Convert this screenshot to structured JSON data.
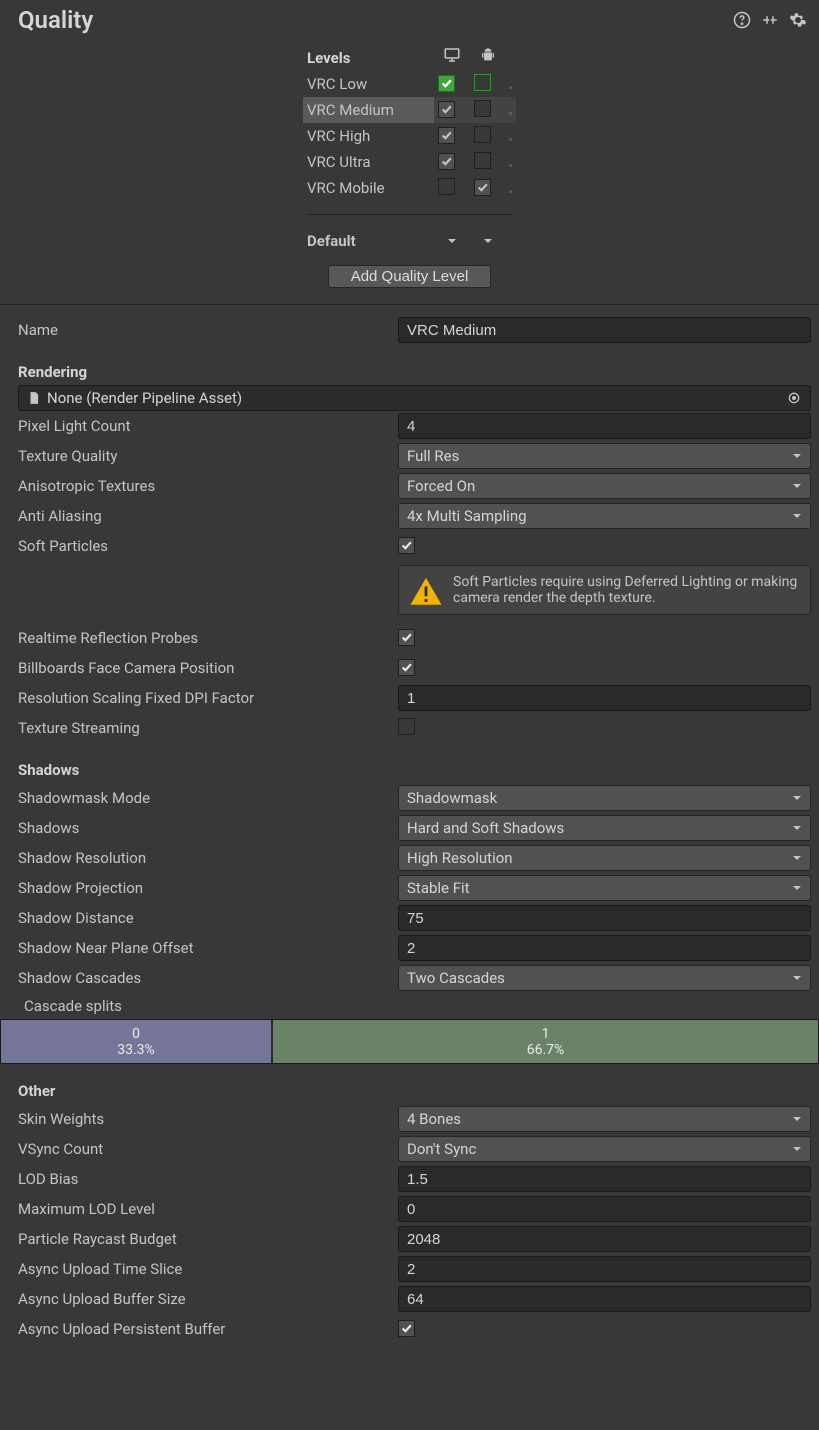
{
  "panel_title": "Quality",
  "levels": {
    "header_label": "Levels",
    "default_label": "Default",
    "add_label": "Add Quality Level",
    "rows": [
      {
        "name": "VRC Low",
        "desktop_default": true,
        "android_checked": false,
        "selected": false
      },
      {
        "name": "VRC Medium",
        "desktop_default": false,
        "android_checked": false,
        "selected": true
      },
      {
        "name": "VRC High",
        "desktop_default": false,
        "android_checked": false,
        "selected": false
      },
      {
        "name": "VRC Ultra",
        "desktop_default": false,
        "android_checked": false,
        "selected": false
      },
      {
        "name": "VRC Mobile",
        "desktop_default": false,
        "android_checked": true,
        "selected": false,
        "desktop_unchecked": true
      }
    ]
  },
  "name_field": {
    "label": "Name",
    "value": "VRC Medium"
  },
  "rendering": {
    "heading": "Rendering",
    "pipeline_asset": "None (Render Pipeline Asset)",
    "pixel_light_count": {
      "label": "Pixel Light Count",
      "value": "4"
    },
    "texture_quality": {
      "label": "Texture Quality",
      "value": "Full Res"
    },
    "anisotropic_textures": {
      "label": "Anisotropic Textures",
      "value": "Forced On"
    },
    "anti_aliasing": {
      "label": "Anti Aliasing",
      "value": "4x Multi Sampling"
    },
    "soft_particles": {
      "label": "Soft Particles",
      "value": true
    },
    "soft_particles_warning": "Soft Particles require using Deferred Lighting or making camera render the depth texture.",
    "realtime_reflection": {
      "label": "Realtime Reflection Probes",
      "value": true
    },
    "billboards_face": {
      "label": "Billboards Face Camera Position",
      "value": true
    },
    "resolution_scaling_dpi": {
      "label": "Resolution Scaling Fixed DPI Factor",
      "value": "1"
    },
    "texture_streaming": {
      "label": "Texture Streaming",
      "value": false
    }
  },
  "shadows": {
    "heading": "Shadows",
    "shadowmask_mode": {
      "label": "Shadowmask Mode",
      "value": "Shadowmask"
    },
    "shadows": {
      "label": "Shadows",
      "value": "Hard and Soft Shadows"
    },
    "shadow_resolution": {
      "label": "Shadow Resolution",
      "value": "High Resolution"
    },
    "shadow_projection": {
      "label": "Shadow Projection",
      "value": "Stable Fit"
    },
    "shadow_distance": {
      "label": "Shadow Distance",
      "value": "75"
    },
    "shadow_near_plane": {
      "label": "Shadow Near Plane Offset",
      "value": "2"
    },
    "shadow_cascades": {
      "label": "Shadow Cascades",
      "value": "Two Cascades"
    },
    "cascade_splits_label": "Cascade splits",
    "cascade_splits": [
      {
        "index": "0",
        "pct": "33.3%"
      },
      {
        "index": "1",
        "pct": "66.7%"
      }
    ]
  },
  "other": {
    "heading": "Other",
    "skin_weights": {
      "label": "Skin Weights",
      "value": "4 Bones"
    },
    "vsync_count": {
      "label": "VSync Count",
      "value": "Don't Sync"
    },
    "lod_bias": {
      "label": "LOD Bias",
      "value": "1.5"
    },
    "max_lod": {
      "label": "Maximum LOD Level",
      "value": "0"
    },
    "particle_raycast": {
      "label": "Particle Raycast Budget",
      "value": "2048"
    },
    "async_upload_time": {
      "label": "Async Upload Time Slice",
      "value": "2"
    },
    "async_upload_buffer": {
      "label": "Async Upload Buffer Size",
      "value": "64"
    },
    "async_upload_persistent": {
      "label": "Async Upload Persistent Buffer",
      "value": true
    }
  }
}
